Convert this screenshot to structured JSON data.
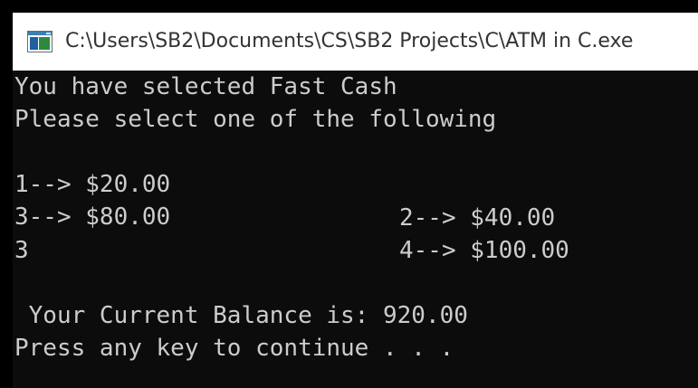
{
  "window": {
    "title": "C:\\Users\\SB2\\Documents\\CS\\SB2 Projects\\C\\ATM in C.exe",
    "icon": "console-app-icon"
  },
  "console": {
    "line1": "You have selected Fast Cash",
    "line2": "Please select one of the following",
    "options": [
      {
        "label": "1--> $20.00"
      },
      {
        "label": "2--> $40.00"
      },
      {
        "label": "3--> $80.00"
      },
      {
        "label": "4--> $100.00"
      }
    ],
    "user_input": "3",
    "balance_line": " Your Current Balance is: 920.00",
    "prompt": "Press any key to continue . . ."
  },
  "colors": {
    "console_background": "#0c0c0c",
    "console_text": "#cccccc",
    "titlebar_background": "#ffffff",
    "title_text": "#333333"
  }
}
